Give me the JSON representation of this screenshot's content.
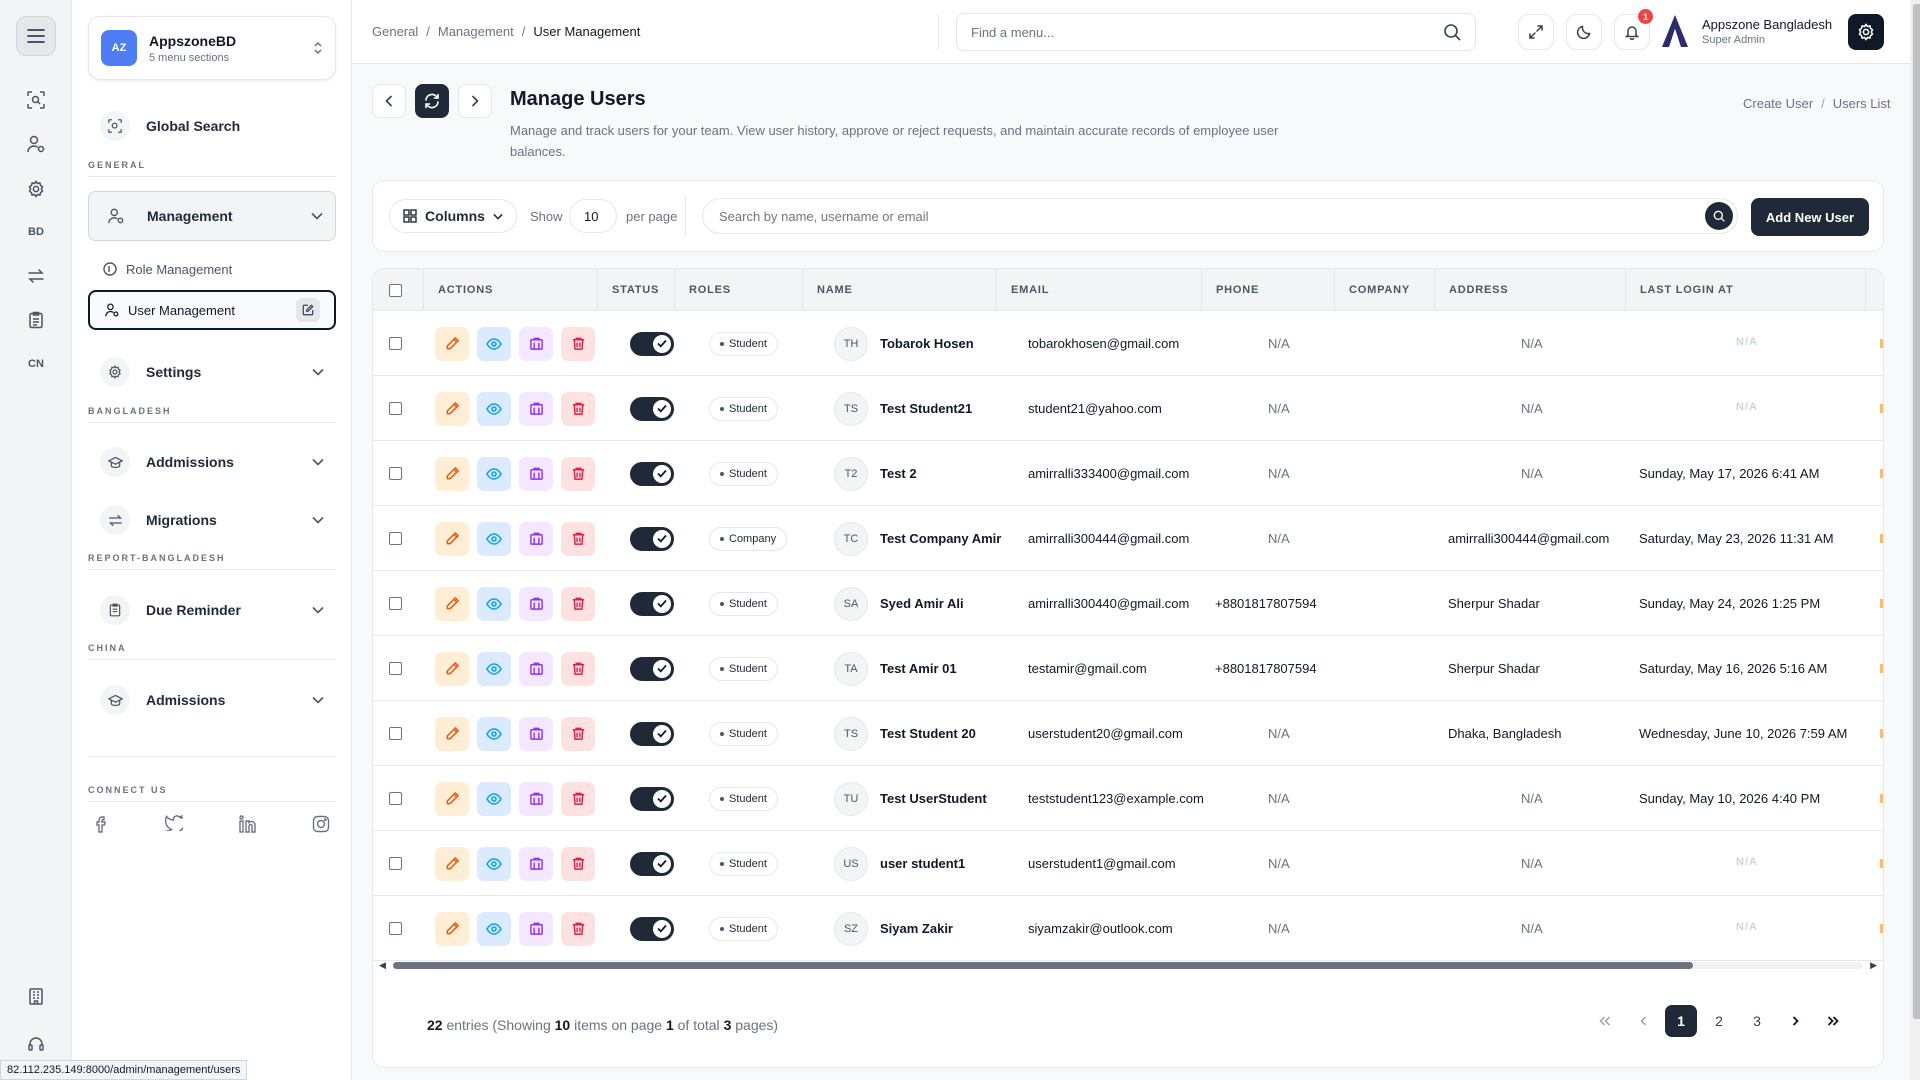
{
  "workspace": {
    "initials": "AZ",
    "name": "AppszoneBD",
    "subtitle": "5 menu sections"
  },
  "rail": {
    "labels": [
      "BD",
      "CN"
    ]
  },
  "sidebar": {
    "global_search": "Global Search",
    "sections": {
      "general": "GENERAL",
      "bangladesh": "BANGLADESH",
      "report": "REPORT-BANGLADESH",
      "china": "CHINA",
      "connect": "CONNECT US"
    },
    "management": "Management",
    "role_management": "Role Management",
    "user_management": "User Management",
    "settings": "Settings",
    "admissions_bd": "Addmissions",
    "migrations": "Migrations",
    "due_reminder": "Due Reminder",
    "admissions_cn": "Admissions"
  },
  "topbar": {
    "breadcrumb": [
      "General",
      "Management",
      "User Management"
    ],
    "find_placeholder": "Find a menu...",
    "notification_count": "1",
    "user_name": "Appszone Bangladesh",
    "user_role": "Super Admin"
  },
  "page": {
    "title": "Manage Users",
    "description": "Manage and track users for your team. View user history, approve or reject requests, and maintain accurate records of employee user balances.",
    "action_create": "Create User",
    "action_list": "Users List"
  },
  "toolbar": {
    "columns_label": "Columns",
    "show_label": "Show",
    "per_page_value": "10",
    "per_page_label": "per page",
    "search_placeholder": "Search by name, username or email",
    "add_button": "Add New User"
  },
  "table": {
    "headers": [
      "ACTIONS",
      "STATUS",
      "ROLES",
      "NAME",
      "EMAIL",
      "PHONE",
      "COMPANY",
      "ADDRESS",
      "LAST LOGIN AT"
    ],
    "rows": [
      {
        "initials": "TH",
        "name": "Tobarok Hosen",
        "email": "tobarokhosen@gmail.com",
        "role": "Student",
        "phone": "N/A",
        "company": "",
        "address": "N/A",
        "last_login": "N/A"
      },
      {
        "initials": "TS",
        "name": "Test Student21",
        "email": "student21@yahoo.com",
        "role": "Student",
        "phone": "N/A",
        "company": "",
        "address": "N/A",
        "last_login": "N/A"
      },
      {
        "initials": "T2",
        "name": "Test 2",
        "email": "amirralli333400@gmail.com",
        "role": "Student",
        "phone": "N/A",
        "company": "",
        "address": "N/A",
        "last_login": "Sunday, May 17, 2026 6:41 AM"
      },
      {
        "initials": "TC",
        "name": "Test Company Amir",
        "email": "amirralli300444@gmail.com",
        "role": "Company",
        "phone": "N/A",
        "company": "",
        "address": "amirralli300444@gmail.com",
        "last_login": "Saturday, May 23, 2026 11:31 AM"
      },
      {
        "initials": "SA",
        "name": "Syed Amir Ali",
        "email": "amirralli300440@gmail.com",
        "role": "Student",
        "phone": "+8801817807594",
        "company": "",
        "address": "Sherpur Shadar",
        "last_login": "Sunday, May 24, 2026 1:25 PM"
      },
      {
        "initials": "TA",
        "name": "Test Amir 01",
        "email": "testamir@gmail.com",
        "role": "Student",
        "phone": "+8801817807594",
        "company": "",
        "address": "Sherpur Shadar",
        "last_login": "Saturday, May 16, 2026 5:16 AM"
      },
      {
        "initials": "TS",
        "name": "Test Student 20",
        "email": "userstudent20@gmail.com",
        "role": "Student",
        "phone": "N/A",
        "company": "",
        "address": "Dhaka, Bangladesh",
        "last_login": "Wednesday, June 10, 2026 7:59 AM"
      },
      {
        "initials": "TU",
        "name": "Test UserStudent",
        "email": "teststudent123@example.com",
        "role": "Student",
        "phone": "N/A",
        "company": "",
        "address": "N/A",
        "last_login": "Sunday, May 10, 2026 4:40 PM"
      },
      {
        "initials": "US",
        "name": "user student1",
        "email": "userstudent1@gmail.com",
        "role": "Student",
        "phone": "N/A",
        "company": "",
        "address": "N/A",
        "last_login": "N/A"
      },
      {
        "initials": "SZ",
        "name": "Siyam Zakir",
        "email": "siyamzakir@outlook.com",
        "role": "Student",
        "phone": "N/A",
        "company": "",
        "address": "N/A",
        "last_login": "N/A"
      }
    ]
  },
  "pagination": {
    "total_entries": "22",
    "entries_label": "entries (Showing",
    "items_on_page": "10",
    "items_label": "items on page",
    "current_page": "1",
    "of_total_label": "of total",
    "total_pages": "3",
    "pages_label": "pages)",
    "pages": [
      "1",
      "2",
      "3"
    ]
  },
  "status_url": "82.112.235.149:8000/admin/management/users"
}
